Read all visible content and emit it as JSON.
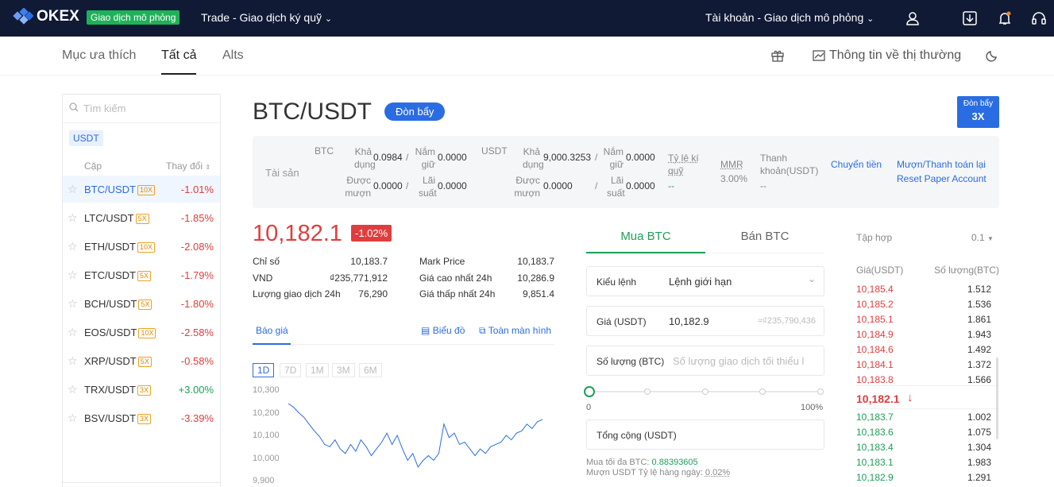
{
  "header": {
    "logo": "OKEX",
    "mode_badge": "Giao dịch mô phỏng",
    "trade_menu": "Trade - Giao dịch ký quỹ",
    "account_menu": "Tài khoản - Giao dịch mô phỏng"
  },
  "subnav": {
    "tabs": [
      "Mục ưa thích",
      "Tất cả",
      "Alts"
    ],
    "market_info": "Thông tin về thị thường"
  },
  "sidebar": {
    "search_placeholder": "Tìm kiếm",
    "quote_tag": "USDT",
    "col_pair": "Cặp",
    "col_change": "Thay đổi",
    "pairs": [
      {
        "name": "BTC/USDT",
        "lev": "10X",
        "change": "-1.01%"
      },
      {
        "name": "LTC/USDT",
        "lev": "5X",
        "change": "-1.85%"
      },
      {
        "name": "ETH/USDT",
        "lev": "10X",
        "change": "-2.08%"
      },
      {
        "name": "ETC/USDT",
        "lev": "5X",
        "change": "-1.79%"
      },
      {
        "name": "BCH/USDT",
        "lev": "5X",
        "change": "-1.80%"
      },
      {
        "name": "EOS/USDT",
        "lev": "10X",
        "change": "-2.58%"
      },
      {
        "name": "XRP/USDT",
        "lev": "5X",
        "change": "-0.58%"
      },
      {
        "name": "TRX/USDT",
        "lev": "3X",
        "change": "+3.00%"
      },
      {
        "name": "BSV/USDT",
        "lev": "3X",
        "change": "-3.39%"
      }
    ]
  },
  "market": {
    "pair": "BTC/USDT",
    "leverage_btn": "Đòn bẩy",
    "leverage_box_label": "Đòn bẩy",
    "leverage_box_value": "3X"
  },
  "assets": {
    "label": "Tài sản",
    "btc": "BTC",
    "usdt": "USDT",
    "avail": "Khả dụng",
    "frozen": "Nắm giữ",
    "borrowed": "Được mượn",
    "interest": "Lãi suất",
    "btc_avail": "0.0984",
    "btc_frozen": "0.0000",
    "btc_borrowed": "0.0000",
    "btc_interest": "0.0000",
    "usdt_avail": "9,000.3253",
    "usdt_frozen": "0.0000",
    "usdt_borrowed": "0.0000",
    "usdt_interest": "0.0000",
    "risk_label": "Tỷ lệ kí quỹ",
    "risk_value": "--",
    "mmr_label": "MMR",
    "mmr_value": "3.00%",
    "liq_label": "Thanh khoản(USDT)",
    "liq_value": "--",
    "transfer": "Chuyển tiền",
    "borrow": "Mượn/Thanh toán lại",
    "reset": "Reset Paper Account"
  },
  "ticker": {
    "price": "10,182.1",
    "change": "-1.02%",
    "index_label": "Chỉ số",
    "index": "10,183.7",
    "mark_label": "Mark Price",
    "mark": "10,183.7",
    "vnd_label": "VND",
    "vnd": "₫235,771,912",
    "high_label": "Giá cao nhất 24h",
    "high": "10,286.9",
    "vol_label": "Lượng giao dịch 24h",
    "vol": "76,290",
    "low_label": "Giá thấp nhất 24h",
    "low": "9,851.4"
  },
  "chart_tabs": {
    "quote": "Báo giá",
    "chart": "Biểu đồ",
    "fullscreen": "Toàn màn hình",
    "timeframes": [
      "1D",
      "7D",
      "1M",
      "3M",
      "6M"
    ]
  },
  "chart_data": {
    "type": "line",
    "title": "",
    "xlabel": "",
    "ylabel": "",
    "yticks": [
      "10,300",
      "10,200",
      "10,100",
      "10,000",
      "9,900"
    ],
    "ylim": [
      9900,
      10320
    ],
    "values": [
      10240,
      10225,
      10200,
      10180,
      10150,
      10120,
      10095,
      10060,
      10050,
      10080,
      10040,
      10020,
      10060,
      10030,
      10080,
      10050,
      10010,
      10040,
      10070,
      10110,
      10060,
      10100,
      10040,
      9990,
      10020,
      9960,
      9990,
      10010,
      9990,
      10020,
      10150,
      10090,
      10110,
      10060,
      10070,
      10040,
      10010,
      10040,
      10020,
      10050,
      10060,
      10070,
      10100,
      10080,
      10110,
      10120,
      10150,
      10130,
      10160,
      10170
    ]
  },
  "order": {
    "buy_tab": "Mua BTC",
    "sell_tab": "Bán BTC",
    "type_label": "Kiểu lệnh",
    "type_value": "Lệnh giới hạn",
    "price_label": "Giá (USDT)",
    "price_value": "10,182.9",
    "price_vnd": "≈₫235,790,436",
    "qty_label": "Số lượng (BTC)",
    "qty_placeholder": "Số lượng giao dịch tối thiểu l",
    "slider_min": "0",
    "slider_max": "100%",
    "total_label": "Tổng cộng (USDT)",
    "max_buy_label": "Mua tối đa BTC:",
    "max_buy": "0.88393605",
    "borrow_label": "Mượn USDT Tỷ lệ hàng ngày:",
    "borrow_rate": "0.02%"
  },
  "orderbook": {
    "group_label": "Tập hợp",
    "group_value": "0.1",
    "col_price": "Giá(USDT)",
    "col_qty": "Số lượng(BTC)",
    "asks": [
      [
        "10,185.4",
        "1.512"
      ],
      [
        "10,185.2",
        "1.536"
      ],
      [
        "10,185.1",
        "1.861"
      ],
      [
        "10,184.9",
        "1.943"
      ],
      [
        "10,184.6",
        "1.492"
      ],
      [
        "10,184.1",
        "1.372"
      ],
      [
        "10,183.8",
        "1.566"
      ]
    ],
    "last": "10,182.1",
    "bids": [
      [
        "10,183.7",
        "1.002"
      ],
      [
        "10,183.6",
        "1.075"
      ],
      [
        "10,183.4",
        "1.304"
      ],
      [
        "10,183.1",
        "1.983"
      ],
      [
        "10,182.9",
        "1.291"
      ]
    ]
  },
  "colors": {
    "up": "#1e9e57",
    "down": "#e03e3e",
    "accent": "#2a6de3",
    "header_bg": "#101a35"
  }
}
